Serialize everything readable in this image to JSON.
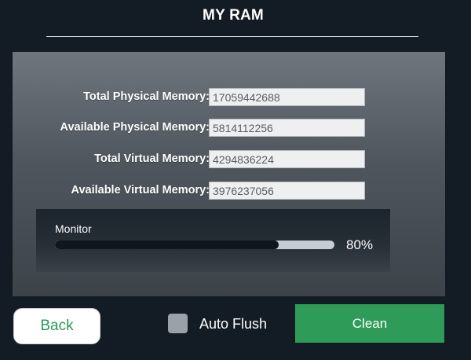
{
  "header": {
    "title": "MY RAM"
  },
  "memory": {
    "rows": [
      {
        "label": "Total Physical Memory:",
        "value": "17059442688"
      },
      {
        "label": "Available Physical Memory:",
        "value": "5814112256"
      },
      {
        "label": "Total Virtual Memory:",
        "value": "4294836224"
      },
      {
        "label": "Available Virtual Memory:",
        "value": "3976237056"
      }
    ]
  },
  "monitor": {
    "label": "Monitor",
    "percent": 80,
    "percent_label": "80%"
  },
  "footer": {
    "back_label": "Back",
    "auto_flush_label": "Auto Flush",
    "auto_flush_checked": false,
    "clean_label": "Clean"
  },
  "colors": {
    "background": "#131b25",
    "accent_green": "#2f9b58",
    "progress_fill": "#10161d",
    "progress_track": "#c4ccd5"
  }
}
